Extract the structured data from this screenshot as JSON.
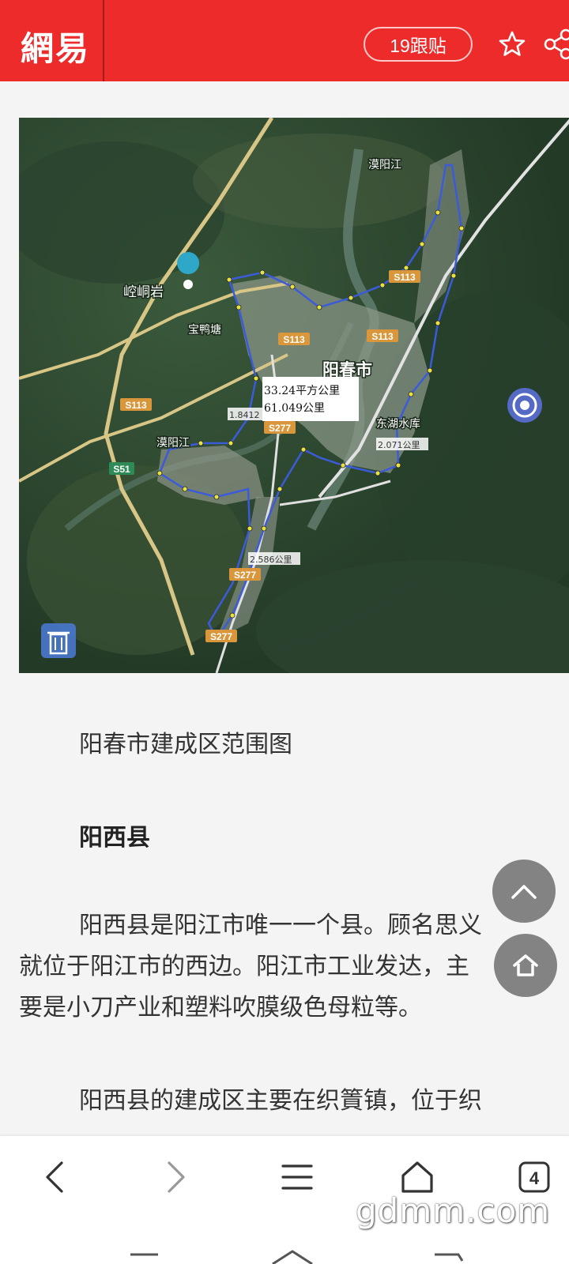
{
  "header": {
    "logo": "網易",
    "comment_button": "19跟贴",
    "colors": {
      "brand": "#ee2b2b"
    }
  },
  "map": {
    "labels": {
      "river_top": "漠阳江",
      "landmark": "崆峒岩",
      "village": "宝鸭塘",
      "city": "阳春市",
      "river_left": "漠阳江",
      "reservoir": "东湖水库",
      "area_line1": "33.24平方公里",
      "area_line2": "61.049公里",
      "dist_left": "1.8412",
      "dist_right": "2.071公里",
      "dist_bottom": "2.586公里"
    },
    "road_shields": [
      "S113",
      "S113",
      "S113",
      "S113",
      "S277",
      "S51",
      "S277",
      "S277"
    ]
  },
  "article": {
    "caption": "阳春市建成区范围图",
    "subhead": "阳西县",
    "para1_line1": "阳西县是阳江市唯一一个县。顾名思义",
    "para1_line2": "就位于阳江市的西边。阳江市工业发达，主",
    "para1_line3": "要是小刀产业和塑料吹膜级色母粒等。",
    "para2_line1": "阳西县的建成区主要在织篢镇，位于织"
  },
  "bottom_nav": {
    "tab_count": "4",
    "watermark": "gdmm.com"
  }
}
